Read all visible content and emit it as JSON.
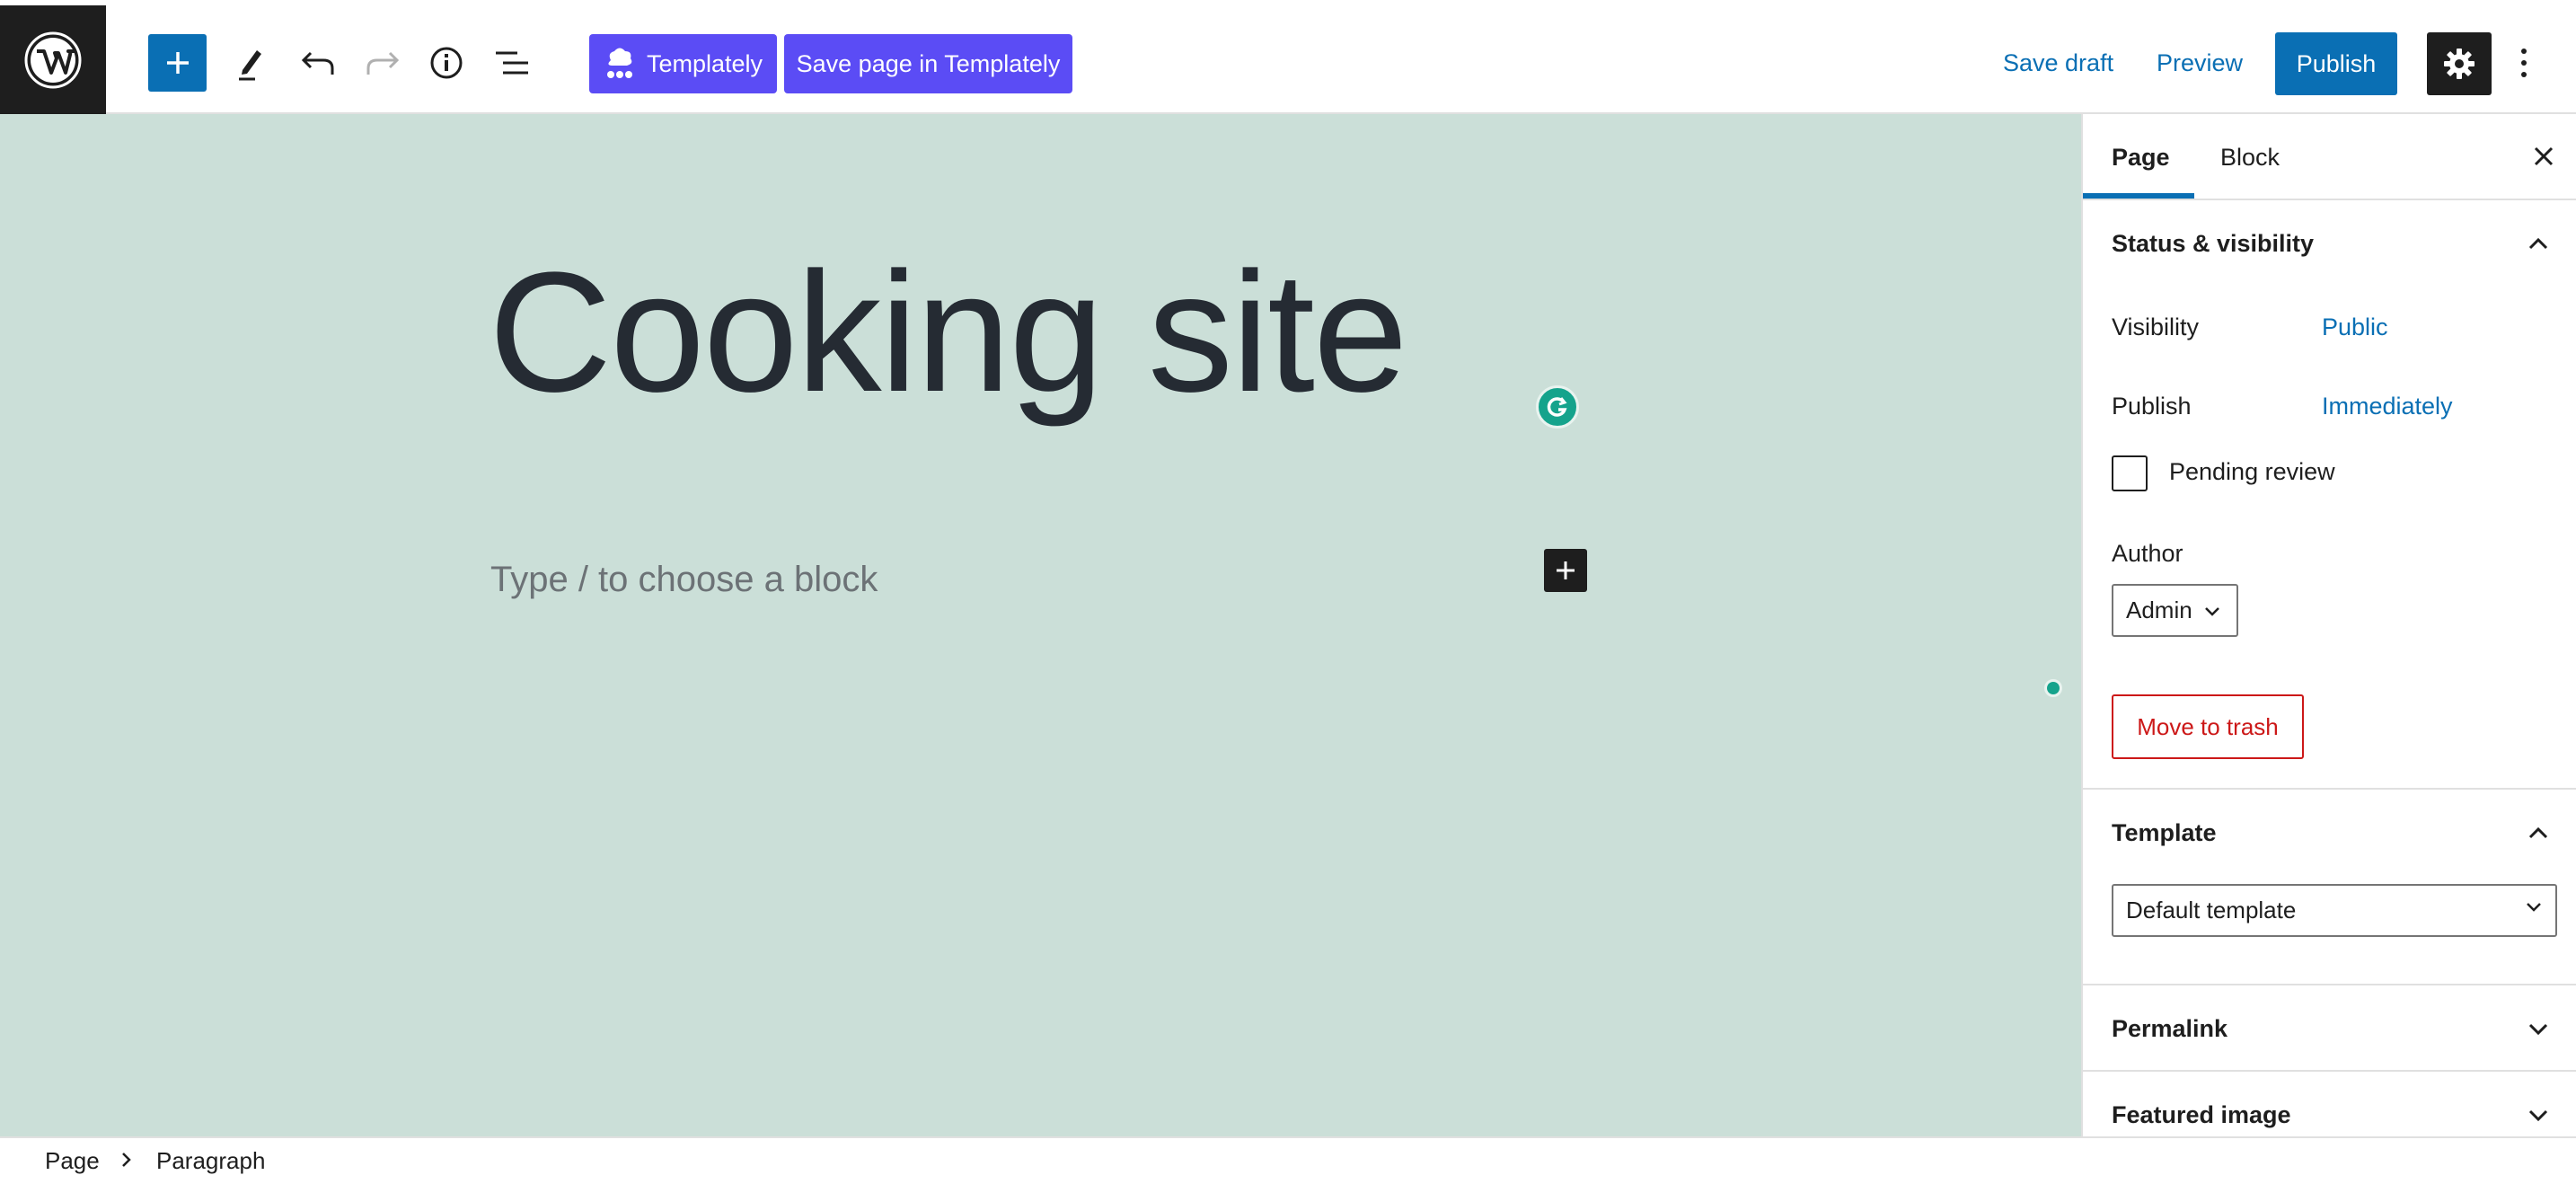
{
  "toolbar": {
    "templately_label": "Templately",
    "save_templately_label": "Save page in Templately",
    "save_draft_label": "Save draft",
    "preview_label": "Preview",
    "publish_label": "Publish"
  },
  "editor": {
    "title": "Cooking site",
    "block_placeholder": "Type / to choose a block"
  },
  "sidebar": {
    "tabs": [
      {
        "label": "Page",
        "active": true
      },
      {
        "label": "Block",
        "active": false
      }
    ],
    "status_visibility": {
      "heading": "Status & visibility",
      "visibility_label": "Visibility",
      "visibility_value": "Public",
      "publish_label": "Publish",
      "publish_value": "Immediately",
      "pending_review_label": "Pending review",
      "pending_review_checked": false,
      "author_label": "Author",
      "author_value": "Admin",
      "trash_label": "Move to trash"
    },
    "template": {
      "heading": "Template",
      "selected": "Default template"
    },
    "permalink": {
      "heading": "Permalink"
    },
    "featured_image": {
      "heading": "Featured image"
    }
  },
  "breadcrumb": {
    "items": [
      "Page",
      "Paragraph"
    ]
  },
  "colors": {
    "accent": "#0a6fb4",
    "templately": "#5b4cf5",
    "canvas_bg": "#cbdfd8",
    "danger": "#cc1818",
    "grammarly": "#15a38c"
  }
}
